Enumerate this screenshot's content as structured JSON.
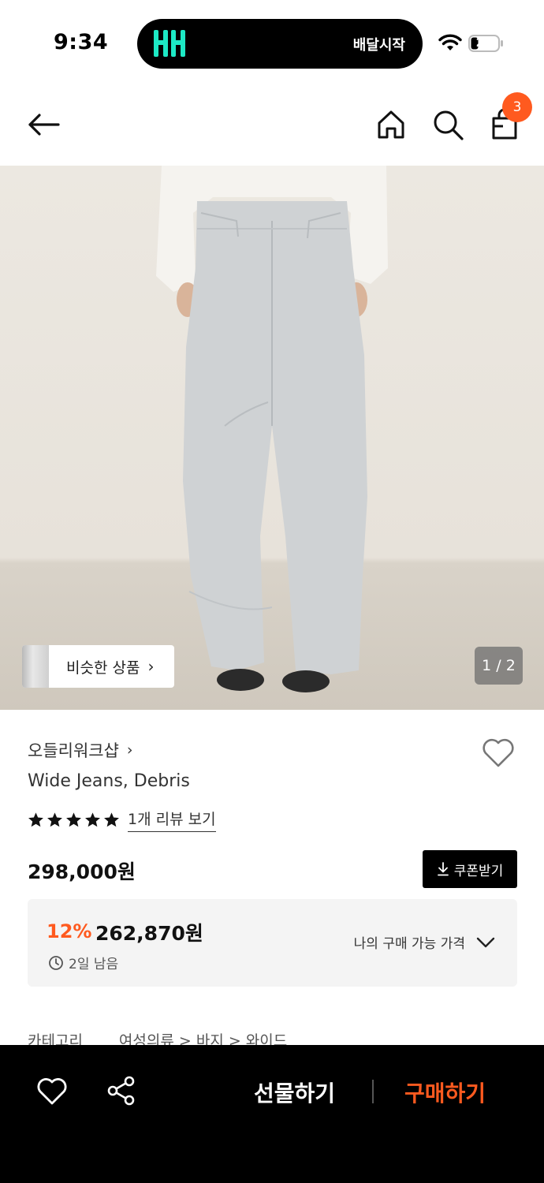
{
  "status_bar": {
    "time": "9:34",
    "island_text": "배달시작",
    "battery_level": "21",
    "island_logo_icon": "baemin-logo-icon",
    "wifi_icon": "wifi-icon"
  },
  "header": {
    "back_icon": "arrow-left-icon",
    "home_icon": "home-icon",
    "search_icon": "search-icon",
    "cart_icon": "shopping-bag-icon",
    "cart_badge": "3"
  },
  "gallery": {
    "similar_label": "비슷한 상품",
    "similar_chevron": "›",
    "page_indicator": "1 / 2"
  },
  "product": {
    "brand": "오들리워크샵",
    "brand_chevron": "›",
    "name": "Wide Jeans, Debris",
    "star_count": 5,
    "review_link": "1개 리뷰 보기",
    "price": "298,000원",
    "coupon_label": "쿠폰받기",
    "discount_rate": "12%",
    "discount_price": "262,870원",
    "remaining": "2일 남음",
    "my_price_label": "나의 구매 가능 가격"
  },
  "category": {
    "label": "카테고리",
    "path": "여성의류 > 바지 > 와이드"
  },
  "bottom_bar": {
    "gift_label": "선물하기",
    "buy_label": "구매하기"
  },
  "colors": {
    "accent": "#ff5a1f",
    "island_logo": "#1de9c5"
  }
}
